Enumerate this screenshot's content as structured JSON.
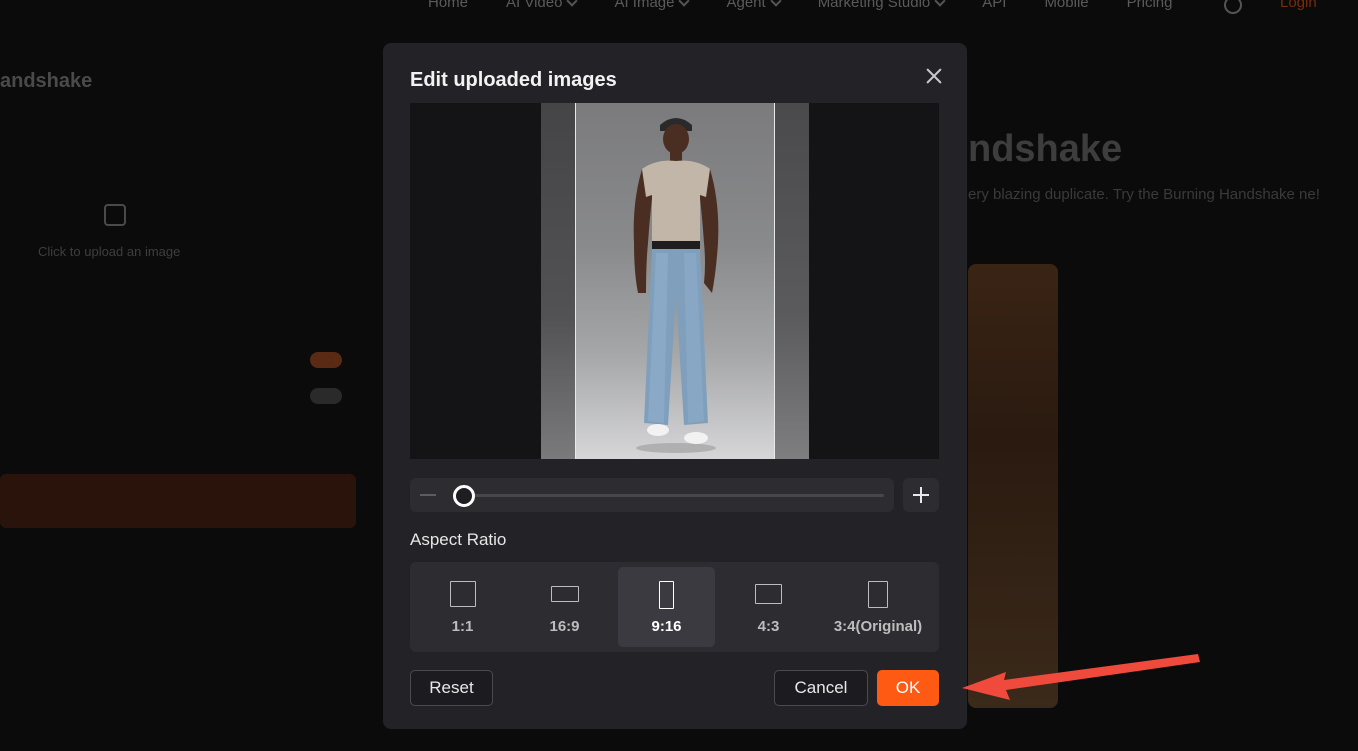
{
  "background": {
    "nav": [
      "Home",
      "AI Video",
      "AI Image",
      "Agent",
      "Marketing Studio",
      "API",
      "Mobile",
      "Pricing"
    ],
    "nav_dropdown_flags": [
      false,
      true,
      true,
      true,
      true,
      false,
      false,
      false
    ],
    "login_label": "Login",
    "left_title": "andshake",
    "upload_text": "Click to upload an image",
    "right_title": "ndshake",
    "right_subtitle": "ery blazing duplicate. Try the Burning Handshake ne!"
  },
  "modal": {
    "title": "Edit uploaded images",
    "zoom_value": 0.0,
    "aspect_ratio_label": "Aspect Ratio",
    "aspect_ratios": [
      {
        "label": "1:1",
        "shape": "square"
      },
      {
        "label": "16:9",
        "shape": "wide"
      },
      {
        "label": "9:16",
        "shape": "tall"
      },
      {
        "label": "4:3",
        "shape": "landscape"
      },
      {
        "label": "3:4(Original)",
        "shape": "portrait"
      }
    ],
    "selected_aspect_ratio": "9:16",
    "reset_label": "Reset",
    "cancel_label": "Cancel",
    "ok_label": "OK"
  },
  "colors": {
    "accent": "#ff5a14",
    "annotation_arrow": "#f04a3c",
    "modal_bg": "#232327"
  },
  "icons": [
    "close-icon",
    "minus-icon",
    "plus-icon",
    "globe-icon",
    "upload-icon"
  ]
}
